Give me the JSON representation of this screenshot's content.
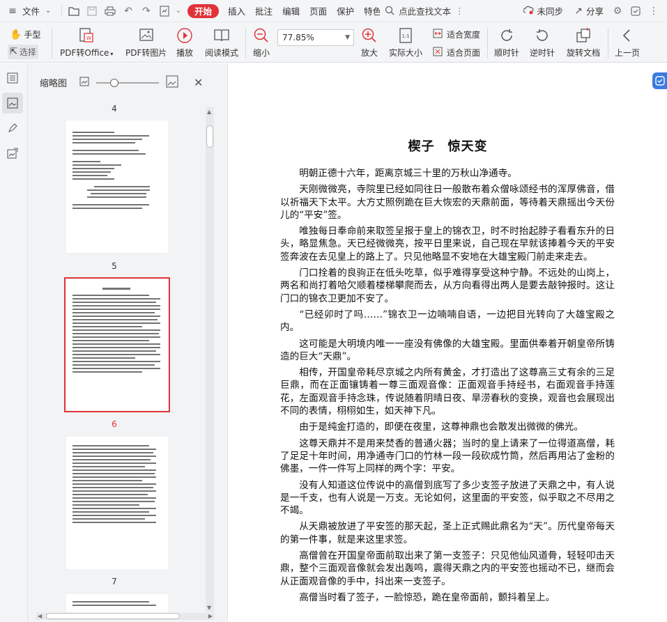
{
  "menubar": {
    "file_label": "文件",
    "tabs": [
      "开始",
      "插入",
      "批注",
      "编辑",
      "页面",
      "保护",
      "特色"
    ],
    "active_tab": "开始",
    "search_label": "点此查找文本",
    "sync_label": "未同步",
    "share_label": "分享"
  },
  "toolbar": {
    "hand_label": "手型",
    "select_label": "选择",
    "pdf_to_office": "PDF转Office",
    "pdf_to_image": "PDF转图片",
    "play": "播放",
    "read_mode": "阅读模式",
    "zoom_out": "缩小",
    "zoom_value": "77.85%",
    "zoom_in": "放大",
    "actual_size": "实际大小",
    "fit_width": "适合宽度",
    "fit_page": "适合页面",
    "rotate_cw": "顺时针",
    "rotate_ccw": "逆时针",
    "rotate_doc": "旋转文档",
    "prev_page": "上一页"
  },
  "thumbnails": {
    "title": "缩略图",
    "pages": [
      "4",
      "5",
      "6",
      "7"
    ],
    "current_page": "6"
  },
  "document": {
    "title": "楔子　惊天变",
    "paragraphs": [
      "明朝正德十六年，距离京城三十里的万秋山净通寺。",
      "天刚微微亮，寺院里已经如同往日一般散布着众僧咏颂经书的浑厚佛音，借以祈福天下太平。大方丈照例跪在巨大恢宏的天鼎前面，等待着天鼎摇出今天份儿的“平安”签。",
      "唯独每日奉命前来取签呈报于皇上的锦衣卫，时不时抬起脖子看看东升的日头，略显焦急。天已经微微亮，按平日里来说，自己现在早就该捧着今天的平安签奔波在去见皇上的路上了。只见他略显不安地在大雄宝殿门前走来走去。",
      "门口拴着的良驹正在低头吃草，似乎难得享受这种宁静。不远处的山岗上，两名和尚打着哈欠顺着楼梯攀爬而去，从方向看得出两人是要去敲钟报时。这让门口的锦衣卫更加不安了。",
      "“已经卯时了吗……”锦衣卫一边喃喃自语，一边把目光转向了大雄宝殿之内。",
      "这可能是大明境内唯一一座没有佛像的大雄宝殿。里面供奉着开朝皇帝所铸造的巨大“天鼎”。",
      "相传，开国皇帝耗尽京城之内所有黄金，才打造出了这尊高三丈有余的三足巨鼎，而在正面镶铸着一尊三面观音像：正面观音手持经书，右面观音手持莲花，左面观音手持念珠，传说随着阴晴日夜、旱涝春秋的变换，观音也会展现出不同的表情，栩栩如生，如天神下凡。",
      "由于是纯金打造的，即便在夜里，这尊神鼎也会散发出微微的佛光。",
      "这尊天鼎并不是用来焚香的普通火器；当时的皇上请来了一位得道高僧，耗了足足十年时间，用净通寺门口的竹林一段一段砍成竹筒，然后再用沾了金粉的佛墨，一件一件写上同样的两个字：平安。",
      "没有人知道这位传说中的高僧到底写了多少支签子放进了天鼎之中，有人说是一千支，也有人说是一万支。无论如何，这里面的平安签，似乎取之不尽用之不竭。",
      "从天鼎被放进了平安签的那天起，圣上正式赐此鼎名为“天”。历代皇帝每天的第一件事，就是来这里求签。",
      "高僧曾在开国皇帝面前取出来了第一支签子：只见他仙风道骨，轻轻叩击天鼎，整个三面观音像就会发出轰鸣，震得天鼎之内的平安签也摇动不已，继而会从正面观音像的手中，抖出来一支签子。",
      "高僧当时看了签子，一脸惊恐，跪在皇帝面前，颤抖着呈上。"
    ]
  },
  "colors": {
    "accent": "#e0343a",
    "toolbar_bg": "#f4f5f7",
    "panel_bg": "#f2f3f5"
  }
}
